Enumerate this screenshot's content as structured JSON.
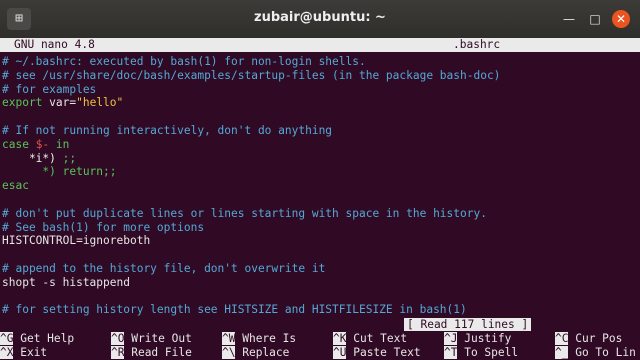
{
  "window": {
    "title": "zubair@ubuntu: ~"
  },
  "nano": {
    "version": "GNU nano 4.8",
    "filename": ".bashrc",
    "status": "[ Read 117 lines ]"
  },
  "lines": [
    {
      "parts": [
        {
          "t": "# ~/.bashrc: executed by bash(1) for non-login shells.",
          "c": "comment"
        }
      ]
    },
    {
      "parts": [
        {
          "t": "# see /usr/share/doc/bash/examples/startup-files (in the package bash-doc)",
          "c": "comment"
        }
      ]
    },
    {
      "parts": [
        {
          "t": "# for examples",
          "c": "comment"
        }
      ]
    },
    {
      "parts": [
        {
          "t": "export",
          "c": "kw"
        },
        {
          "t": " var=",
          "c": "plain"
        },
        {
          "t": "\"hello\"",
          "c": "str"
        }
      ]
    },
    {
      "parts": [
        {
          "t": "",
          "c": "plain"
        }
      ]
    },
    {
      "parts": [
        {
          "t": "# If not running interactively, don't do anything",
          "c": "comment"
        }
      ]
    },
    {
      "parts": [
        {
          "t": "case",
          "c": "kw"
        },
        {
          "t": " $-",
          "c": "var"
        },
        {
          "t": " in",
          "c": "kw"
        }
      ]
    },
    {
      "parts": [
        {
          "t": "    *i*)",
          "c": "pat"
        },
        {
          "t": " ;;",
          "c": "kw"
        }
      ]
    },
    {
      "parts": [
        {
          "t": "      *) return;;",
          "c": "kw"
        }
      ]
    },
    {
      "parts": [
        {
          "t": "esac",
          "c": "kw"
        }
      ]
    },
    {
      "parts": [
        {
          "t": "",
          "c": "plain"
        }
      ]
    },
    {
      "parts": [
        {
          "t": "# don't put duplicate lines or lines starting with space in the history.",
          "c": "comment"
        }
      ]
    },
    {
      "parts": [
        {
          "t": "# See bash(1) for more options",
          "c": "comment"
        }
      ]
    },
    {
      "parts": [
        {
          "t": "HISTCONTROL=ignoreboth",
          "c": "plain"
        }
      ]
    },
    {
      "parts": [
        {
          "t": "",
          "c": "plain"
        }
      ]
    },
    {
      "parts": [
        {
          "t": "# append to the history file, don't overwrite it",
          "c": "comment"
        }
      ]
    },
    {
      "parts": [
        {
          "t": "shopt -s histappend",
          "c": "plain"
        }
      ]
    },
    {
      "parts": [
        {
          "t": "",
          "c": "plain"
        }
      ]
    },
    {
      "parts": [
        {
          "t": "# for setting history length see HISTSIZE and HISTFILESIZE in bash(1)",
          "c": "comment"
        }
      ]
    }
  ],
  "shortcuts": [
    {
      "key": "^G",
      "label": "Get Help"
    },
    {
      "key": "^O",
      "label": "Write Out"
    },
    {
      "key": "^W",
      "label": "Where Is"
    },
    {
      "key": "^K",
      "label": "Cut Text"
    },
    {
      "key": "^J",
      "label": "Justify"
    },
    {
      "key": "^C",
      "label": "Cur Pos"
    },
    {
      "key": "^X",
      "label": "Exit"
    },
    {
      "key": "^R",
      "label": "Read File"
    },
    {
      "key": "^\\",
      "label": "Replace"
    },
    {
      "key": "^U",
      "label": "Paste Text"
    },
    {
      "key": "^T",
      "label": "To Spell"
    },
    {
      "key": "^_",
      "label": "Go To Lin"
    }
  ]
}
